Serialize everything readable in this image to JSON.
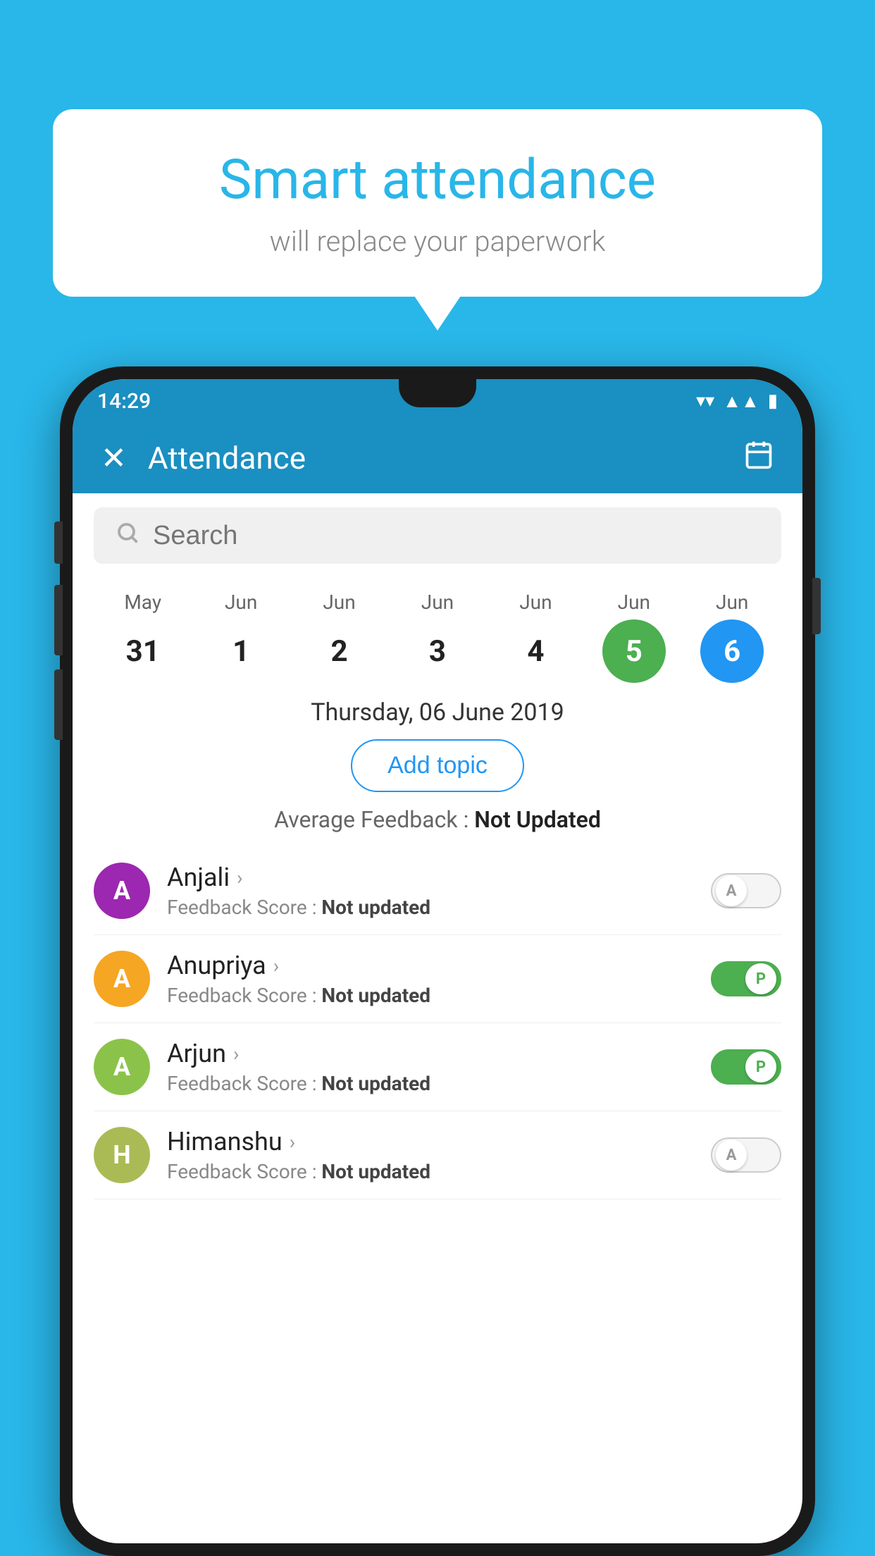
{
  "background_color": "#29b6e8",
  "speech_bubble": {
    "title": "Smart attendance",
    "subtitle": "will replace your paperwork"
  },
  "status_bar": {
    "time": "14:29",
    "icons": [
      "wifi",
      "signal",
      "battery"
    ]
  },
  "app_bar": {
    "close_label": "✕",
    "title": "Attendance",
    "calendar_icon": "📅"
  },
  "search": {
    "placeholder": "Search"
  },
  "calendar": {
    "days": [
      {
        "month": "May",
        "date": "31",
        "state": "normal"
      },
      {
        "month": "Jun",
        "date": "1",
        "state": "normal"
      },
      {
        "month": "Jun",
        "date": "2",
        "state": "normal"
      },
      {
        "month": "Jun",
        "date": "3",
        "state": "normal"
      },
      {
        "month": "Jun",
        "date": "4",
        "state": "normal"
      },
      {
        "month": "Jun",
        "date": "5",
        "state": "today"
      },
      {
        "month": "Jun",
        "date": "6",
        "state": "selected"
      }
    ]
  },
  "selected_date_label": "Thursday, 06 June 2019",
  "add_topic_label": "Add topic",
  "average_feedback_label": "Average Feedback :",
  "average_feedback_value": "Not Updated",
  "students": [
    {
      "name": "Anjali",
      "initial": "A",
      "avatar_color": "#9c27b0",
      "feedback_label": "Feedback Score :",
      "feedback_value": "Not updated",
      "toggle_state": "off",
      "toggle_label": "A"
    },
    {
      "name": "Anupriya",
      "initial": "A",
      "avatar_color": "#f5a623",
      "feedback_label": "Feedback Score :",
      "feedback_value": "Not updated",
      "toggle_state": "on",
      "toggle_label": "P"
    },
    {
      "name": "Arjun",
      "initial": "A",
      "avatar_color": "#8bc34a",
      "feedback_label": "Feedback Score :",
      "feedback_value": "Not updated",
      "toggle_state": "on",
      "toggle_label": "P"
    },
    {
      "name": "Himanshu",
      "initial": "H",
      "avatar_color": "#aabb55",
      "feedback_label": "Feedback Score :",
      "feedback_value": "Not updated",
      "toggle_state": "off",
      "toggle_label": "A"
    }
  ]
}
